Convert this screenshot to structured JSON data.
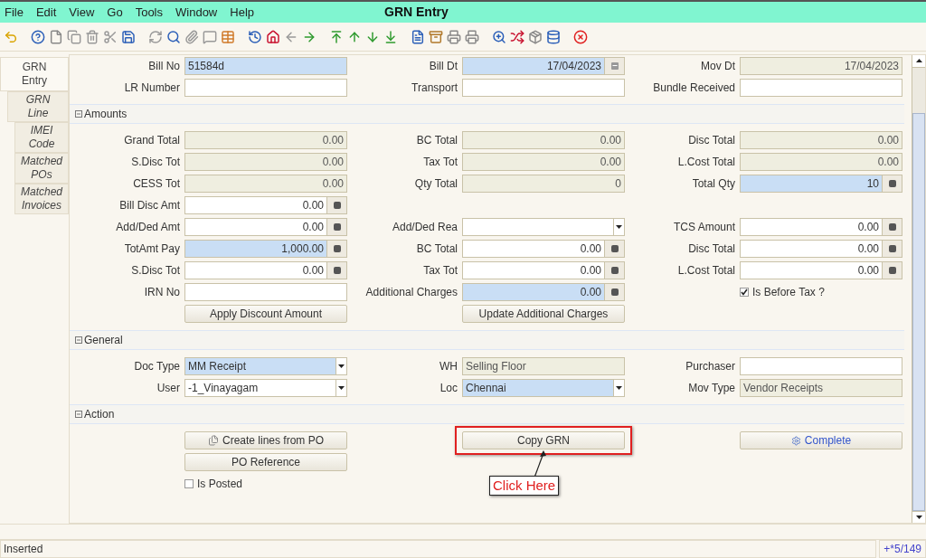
{
  "menu": [
    "File",
    "Edit",
    "View",
    "Go",
    "Tools",
    "Window",
    "Help"
  ],
  "window": {
    "title": "GRN Entry"
  },
  "tabs": [
    {
      "label": "GRN Entry",
      "selected": true
    },
    {
      "label": "GRN Line",
      "selected": false
    },
    {
      "label": "IMEI Code",
      "selected": false
    },
    {
      "label": "Matched POs",
      "selected": false
    },
    {
      "label": "Matched Invoices",
      "selected": false
    }
  ],
  "header": {
    "rows": [
      [
        {
          "kind": "text",
          "label": "Bill No",
          "value": "51584d",
          "readonly": false,
          "mandatory": true
        },
        {
          "kind": "text",
          "label": "Bill Dt",
          "value": "17/04/2023",
          "readonly": false,
          "mandatory": true,
          "numeric": true,
          "date_button": true
        },
        {
          "kind": "text",
          "label": "Mov Dt",
          "value": "17/04/2023",
          "readonly": true,
          "mandatory": false,
          "numeric": true
        }
      ],
      [
        {
          "kind": "text",
          "label": "LR Number",
          "readonly": false,
          "mandatory": false
        },
        {
          "kind": "text",
          "label": "Transport",
          "readonly": false,
          "mandatory": false
        },
        {
          "kind": "text",
          "label": "Bundle Received",
          "readonly": false,
          "mandatory": false
        }
      ]
    ]
  },
  "sections": [
    {
      "title": "Amounts",
      "expanded": true,
      "rows": [
        [
          {
            "kind": "text",
            "label": "Grand Total",
            "value": "0.00",
            "readonly": true,
            "mandatory": false,
            "numeric": true
          },
          {
            "kind": "text",
            "label": "BC Total",
            "value": "0.00",
            "readonly": true,
            "mandatory": false,
            "numeric": true
          },
          {
            "kind": "text",
            "label": "Disc Total",
            "value": "0.00",
            "readonly": true,
            "mandatory": false,
            "numeric": true
          }
        ],
        [
          {
            "kind": "text",
            "label": "S.Disc Tot",
            "value": "0.00",
            "readonly": true,
            "mandatory": false,
            "numeric": true
          },
          {
            "kind": "text",
            "label": "Tax Tot",
            "value": "0.00",
            "readonly": true,
            "mandatory": false,
            "numeric": true
          },
          {
            "kind": "text",
            "label": "L.Cost Total",
            "value": "0.00",
            "readonly": true,
            "mandatory": false,
            "numeric": true
          }
        ],
        [
          {
            "kind": "text",
            "label": "CESS Tot",
            "value": "0.00",
            "readonly": true,
            "mandatory": false,
            "numeric": true
          },
          {
            "kind": "text",
            "label": "Qty Total",
            "value": "0",
            "readonly": true,
            "mandatory": false,
            "numeric": true
          },
          {
            "kind": "text",
            "label": "Total Qty",
            "value": "10",
            "readonly": false,
            "mandatory": true,
            "numeric": true,
            "calc_button": true
          }
        ],
        [
          {
            "kind": "text",
            "label": "Bill Disc Amt",
            "value": "0.00",
            "readonly": false,
            "mandatory": false,
            "numeric": true,
            "calc_button": true
          },
          {
            "kind": "empty"
          },
          {
            "kind": "empty"
          }
        ],
        [
          {
            "kind": "text",
            "label": "Add/Ded Amt",
            "value": "0.00",
            "readonly": false,
            "mandatory": false,
            "numeric": true,
            "calc_button": true
          },
          {
            "kind": "select",
            "label": "Add/Ded Rea",
            "readonly": false,
            "mandatory": false
          },
          {
            "kind": "text",
            "label": "TCS Amount",
            "value": "0.00",
            "readonly": false,
            "mandatory": false,
            "numeric": true,
            "calc_button": true
          }
        ],
        [
          {
            "kind": "text",
            "label": "TotAmt Pay",
            "value": "1,000.00",
            "readonly": false,
            "mandatory": true,
            "numeric": true,
            "calc_button": true
          },
          {
            "kind": "text",
            "label": "BC Total",
            "value": "0.00",
            "readonly": false,
            "mandatory": false,
            "numeric": true,
            "calc_button": true
          },
          {
            "kind": "text",
            "label": "Disc Total",
            "value": "0.00",
            "readonly": false,
            "mandatory": false,
            "numeric": true,
            "calc_button": true
          }
        ],
        [
          {
            "kind": "text",
            "label": "S.Disc Tot",
            "value": "0.00",
            "readonly": false,
            "mandatory": false,
            "numeric": true,
            "calc_button": true
          },
          {
            "kind": "text",
            "label": "Tax Tot",
            "value": "0.00",
            "readonly": false,
            "mandatory": false,
            "numeric": true,
            "calc_button": true
          },
          {
            "kind": "text",
            "label": "L.Cost Total",
            "value": "0.00",
            "readonly": false,
            "mandatory": false,
            "numeric": true,
            "calc_button": true
          }
        ],
        [
          {
            "kind": "text",
            "label": "IRN No",
            "readonly": false,
            "mandatory": false
          },
          {
            "kind": "text",
            "label": "Additional Charges",
            "value": "0.00",
            "readonly": false,
            "mandatory": true,
            "numeric": true,
            "calc_button": true
          },
          {
            "kind": "checkbox",
            "label": "Is Before Tax ?",
            "checked": true
          }
        ],
        [
          {
            "kind": "button",
            "label": "Apply Discount Amount"
          },
          {
            "kind": "button",
            "label": "Update Additional Charges"
          },
          {
            "kind": "empty"
          }
        ]
      ]
    },
    {
      "title": "General",
      "expanded": true,
      "rows": [
        [
          {
            "kind": "select",
            "label": "Doc Type",
            "value": "MM Receipt",
            "readonly": false,
            "mandatory": true
          },
          {
            "kind": "text",
            "label": "WH",
            "value": "Selling Floor",
            "readonly": true,
            "mandatory": false
          },
          {
            "kind": "text",
            "label": "Purchaser",
            "readonly": false,
            "mandatory": false
          }
        ],
        [
          {
            "kind": "select",
            "label": "User",
            "value": "-1_Vinayagam",
            "readonly": false,
            "mandatory": false
          },
          {
            "kind": "select",
            "label": "Loc",
            "value": "Chennai",
            "readonly": false,
            "mandatory": true
          },
          {
            "kind": "text",
            "label": "Mov Type",
            "value": "Vendor Receipts",
            "readonly": true,
            "mandatory": false
          }
        ]
      ]
    },
    {
      "title": "Action",
      "expanded": true,
      "rows": [
        [
          {
            "kind": "copy_button",
            "label": "Create lines from PO"
          },
          {
            "kind": "button",
            "label": "Copy GRN",
            "highlighted": true,
            "callout": "Click Here"
          },
          {
            "kind": "process_button",
            "label": "Complete"
          }
        ],
        [
          {
            "kind": "button",
            "label": "PO Reference"
          },
          {
            "kind": "empty"
          },
          {
            "kind": "empty"
          }
        ],
        [
          {
            "kind": "checkbox",
            "label": "Is Posted",
            "checked": false
          }
        ]
      ]
    }
  ],
  "status_bar": {
    "message": "Inserted",
    "record": "+*5/149"
  }
}
